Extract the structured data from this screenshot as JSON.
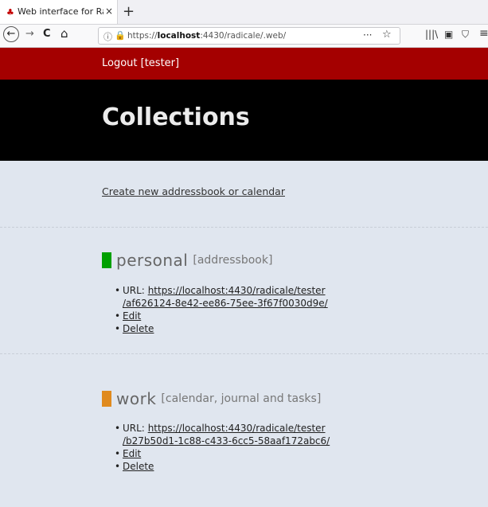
{
  "browser": {
    "tab_title": "Web interface for Radica",
    "tab_favicon": "radicale-favicon",
    "close_glyph": "×",
    "newtab_glyph": "+",
    "back_glyph": "←",
    "forward_glyph": "→",
    "reload_glyph": "C",
    "home_glyph": "⌂",
    "url_prefix": "https://",
    "url_host": "localhost",
    "url_rest": ":4430/radicale/.web/",
    "more_glyph": "···",
    "star_glyph": "☆",
    "library_glyph": "|||\\",
    "sidebar_glyph": "▣",
    "shield_glyph": "⛉",
    "menu_glyph": "≡"
  },
  "header": {
    "logout_label": "Logout [tester]",
    "bar_color": "#a40000"
  },
  "hero": {
    "title": "Collections"
  },
  "main": {
    "create_label": "Create new addressbook or calendar",
    "collections": [
      {
        "name": "personal",
        "type": "[addressbook]",
        "color": "#00a000",
        "url_label": "URL:",
        "url_line1": "https://localhost:4430/radicale/tester",
        "url_line2": "/af626124-8e42-ee86-75ee-3f67f0030d9e/",
        "edit_label": "Edit",
        "delete_label": "Delete"
      },
      {
        "name": "work",
        "type": "[calendar, journal and tasks]",
        "color": "#e08a1e",
        "url_label": "URL:",
        "url_line1": "https://localhost:4430/radicale/tester",
        "url_line2": "/b27b50d1-1c88-c433-6cc5-58aaf172abc6/",
        "edit_label": "Edit",
        "delete_label": "Delete"
      }
    ]
  }
}
